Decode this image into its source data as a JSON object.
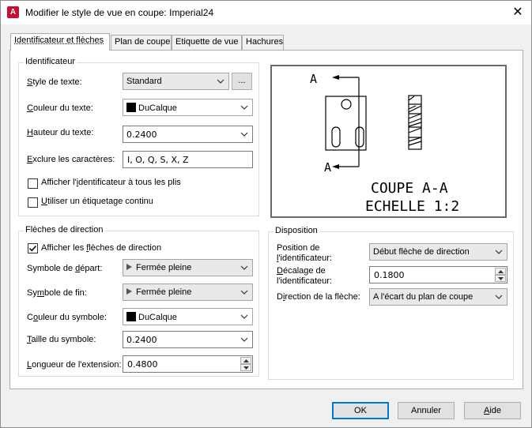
{
  "window": {
    "app_icon_letter": "A",
    "title": "Modifier le style de vue en coupe: Imperial24"
  },
  "tabs": [
    {
      "label": "Identificateur et flèches"
    },
    {
      "label": "Plan de coupe"
    },
    {
      "label": "Etiquette de vue"
    },
    {
      "label": "Hachures"
    }
  ],
  "identifier": {
    "group_title": "Identificateur",
    "text_style": {
      "label_u": "S",
      "label_rest": "tyle de texte:",
      "value": "Standard",
      "browse_label": "..."
    },
    "text_color": {
      "label_u": "C",
      "label_rest": "ouleur du texte:",
      "value": "DuCalque"
    },
    "text_height": {
      "label_u": "H",
      "label_rest": "auteur du texte:",
      "value": "0.2400"
    },
    "exclude_chars": {
      "label_u": "E",
      "label_rest": "xclure les caractères:",
      "value": "I, O, Q, S, X, Z"
    },
    "show_all_plies": {
      "label_pre": "Afficher l'",
      "label_u": "i",
      "label_rest": "dentificateur à tous les plis",
      "checked": false
    },
    "continuous_labeling": {
      "label_u": "U",
      "label_rest": "tiliser un étiquetage continu",
      "checked": false
    }
  },
  "direction_arrows": {
    "group_title": "Flèches de direction",
    "show_arrows": {
      "label_pre": "Afficher les ",
      "label_u": "f",
      "label_rest": "lèches de direction",
      "checked": true
    },
    "start_symbol": {
      "label_pre": "Symbole de ",
      "label_u": "d",
      "label_rest": "épart:",
      "value": "Fermée pleine"
    },
    "end_symbol": {
      "label_pre": "Sy",
      "label_u": "m",
      "label_rest": "bole de fin:",
      "value": "Fermée pleine"
    },
    "symbol_color": {
      "label_pre": "C",
      "label_u": "o",
      "label_rest": "uleur du symbole:",
      "value": "DuCalque"
    },
    "symbol_size": {
      "label_u": "T",
      "label_rest": "aille du symbole:",
      "value": "0.2400"
    },
    "extension_length": {
      "label_u": "L",
      "label_rest": "ongueur de l'extension:",
      "value": "0.4800"
    }
  },
  "preview": {
    "letter_top": "A",
    "letter_bottom": "A",
    "caption_line1": "COUPE A-A",
    "caption_line2": "ECHELLE 1:2"
  },
  "layout_group": {
    "group_title": "Disposition",
    "identifier_position": {
      "label_line1": "Position de",
      "label_line2_u": "l",
      "label_line2_rest": "'identificateur:",
      "value": "Début flèche de direction"
    },
    "identifier_offset": {
      "label_line1_u": "D",
      "label_line1_rest": "écalage de",
      "label_line2": "l'identificateur:",
      "value": "0.1800"
    },
    "arrow_direction": {
      "label_pre": "D",
      "label_u": "i",
      "label_rest": "rection de la flèche:",
      "value": "A l'écart du plan de coupe"
    }
  },
  "buttons": {
    "ok": "OK",
    "cancel": "Annuler",
    "help_u": "A",
    "help_rest": "ide"
  }
}
